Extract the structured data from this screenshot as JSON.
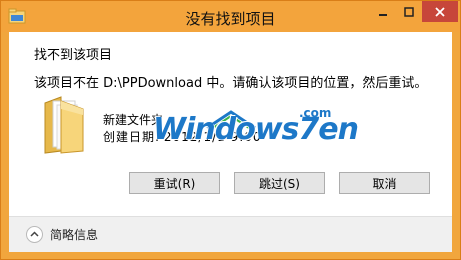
{
  "window": {
    "title": "没有找到项目",
    "accent_color": "#f3a43c",
    "close_color": "#c7463a"
  },
  "dialog": {
    "heading": "找不到该项目",
    "message": "该项目不在 D:\\PPDownload 中。请确认该项目的位置，然后重试。",
    "item": {
      "name": "新建文件夹",
      "date_label": "创建日期:",
      "date_value": "2012/1/1 9:00"
    }
  },
  "watermark": {
    "text": "Windows7en",
    "suffix": ".com"
  },
  "buttons": {
    "retry": "重试(R)",
    "skip": "跳过(S)",
    "cancel": "取消"
  },
  "footer": {
    "details_label": "简略信息",
    "icon": "chevron-up-icon"
  },
  "icons": {
    "app": "file-explorer-icon",
    "folder": "folder-icon",
    "minimize": "minimize-icon",
    "maximize": "maximize-icon",
    "close": "close-icon"
  }
}
